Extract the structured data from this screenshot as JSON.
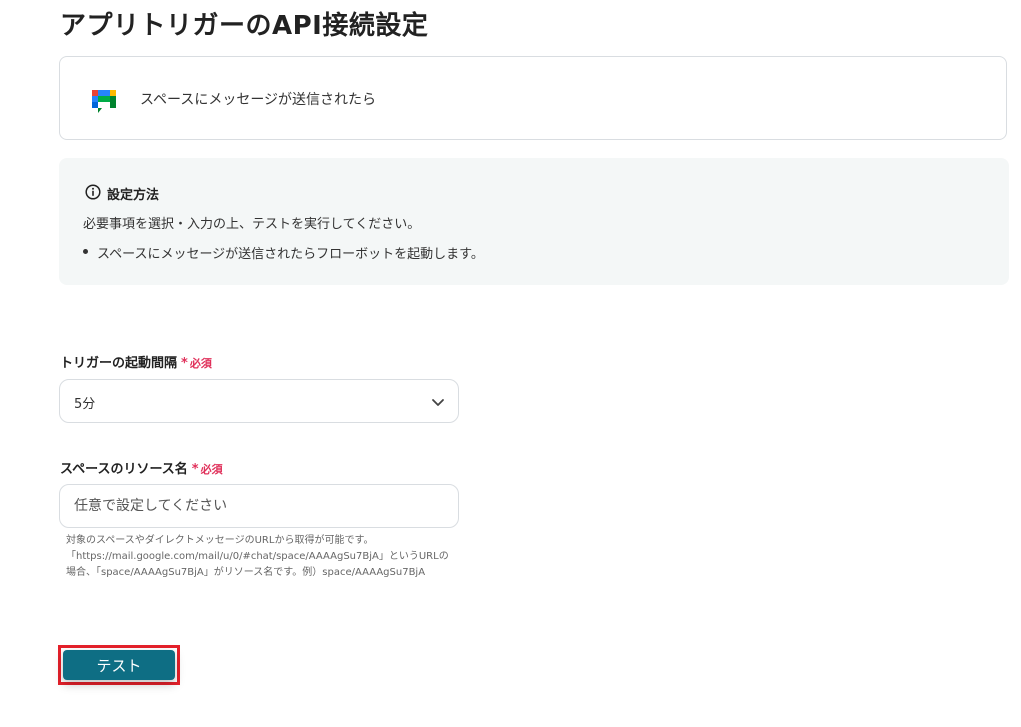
{
  "page": {
    "title": "アプリトリガーのAPI接続設定"
  },
  "trigger": {
    "icon": "google-chat-icon",
    "label": "スペースにメッセージが送信されたら"
  },
  "info": {
    "icon": "info-icon",
    "title": "設定方法",
    "description": "必要事項を選択・入力の上、テストを実行してください。",
    "bullets": [
      "スペースにメッセージが送信されたらフローボットを起動します。"
    ]
  },
  "fields": {
    "interval": {
      "label": "トリガーの起動間隔",
      "required_mark": "*",
      "required_text": "必須",
      "value": "5分"
    },
    "space_name": {
      "label": "スペースのリソース名",
      "required_mark": "*",
      "required_text": "必須",
      "placeholder": "任意で設定してください",
      "value": "",
      "help": "対象のスペースやダイレクトメッセージのURLから取得が可能です。\n「https://mail.google.com/mail/u/0/#chat/space/AAAAgSu7BjA」というURLの\n場合、「space/AAAAgSu7BjA」がリソース名です。例）space/AAAAgSu7BjA"
    }
  },
  "actions": {
    "test_label": "テスト"
  },
  "colors": {
    "accent": "#0e6e84",
    "required": "#e0305a",
    "highlight": "#e5202a",
    "info_bg": "#f4f7f7"
  }
}
